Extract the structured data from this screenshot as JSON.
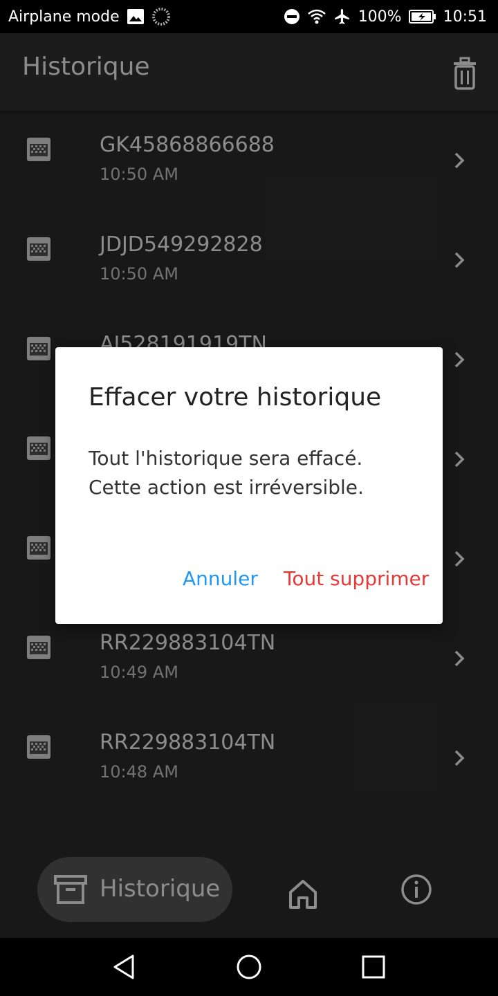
{
  "status_bar": {
    "left_text": "Airplane mode",
    "battery": "100%",
    "time": "10:51"
  },
  "app_bar": {
    "title": "Historique"
  },
  "history_items": [
    {
      "code": "GK45868866688",
      "time": "10:50 AM"
    },
    {
      "code": "JDJD549292828",
      "time": "10:50 AM"
    },
    {
      "code": "AJ528191919TN",
      "time": ""
    },
    {
      "code": "",
      "time": ""
    },
    {
      "code": "",
      "time": ""
    },
    {
      "code": "RR229883104TN",
      "time": "10:49 AM"
    },
    {
      "code": "RR229883104TN",
      "time": "10:48 AM"
    }
  ],
  "bottom_nav": {
    "active_label": "Historique"
  },
  "dialog": {
    "title": "Effacer votre historique",
    "message": "Tout l'historique sera effacé. Cette action est irréversible.",
    "cancel_label": "Annuler",
    "confirm_label": "Tout supprimer"
  },
  "colors": {
    "accent": "#2196f3",
    "danger": "#e53935"
  }
}
